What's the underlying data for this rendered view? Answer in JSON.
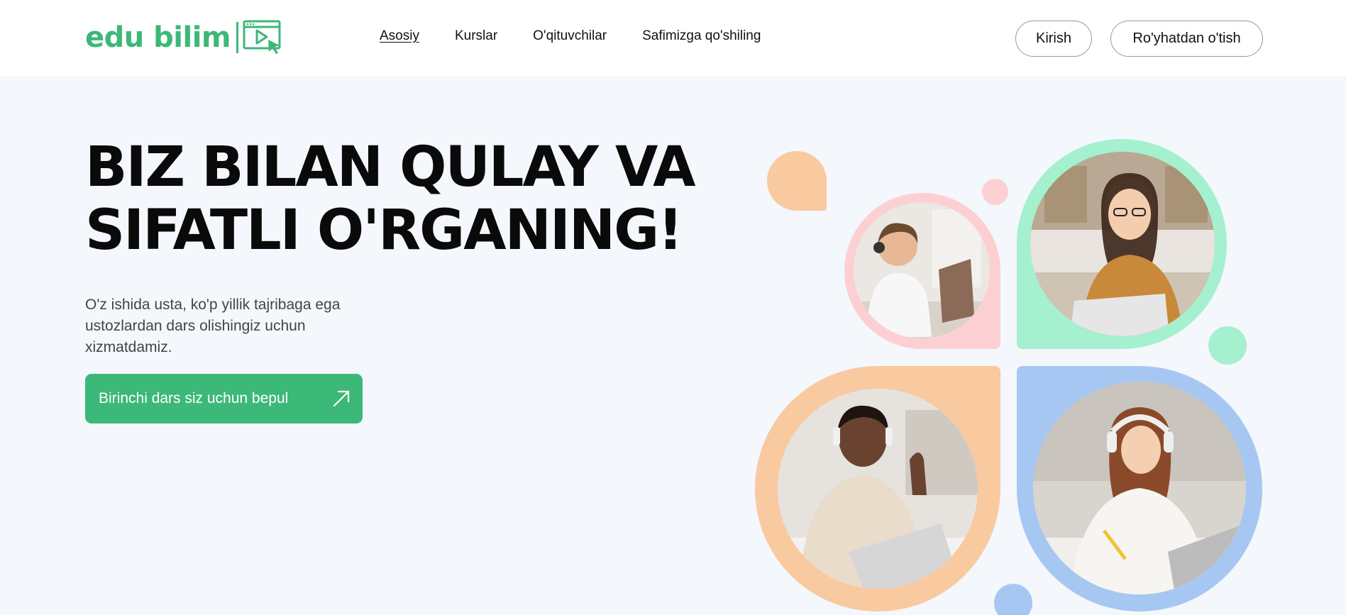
{
  "brand": {
    "logo_text": "edu bilim",
    "accent_color": "#3cb878",
    "logo_icon": "video-player-cursor-icon"
  },
  "nav": {
    "items": [
      {
        "label": "Asosiy",
        "active": true
      },
      {
        "label": "Kurslar",
        "active": false
      },
      {
        "label": "O'qituvchilar",
        "active": false
      },
      {
        "label": "Safimizga qo'shiling",
        "active": false
      }
    ]
  },
  "auth": {
    "login_label": "Kirish",
    "register_label": "Ro'yhatdan o'tish"
  },
  "hero": {
    "title_line1": "BIZ BILAN QULAY VA",
    "title_line2": "SIFATLI O'RGANING!",
    "subtitle": "O'z ishida usta, ko'p yillik tajribaga ega ustozlardan dars olishingiz uchun xizmatdamiz.",
    "cta_label": "Birinchi dars siz uchun bepul",
    "cta_icon": "arrow-up-right-icon"
  },
  "collage": {
    "colors": {
      "peach": "#f9c9a0",
      "pink": "#fcd0d2",
      "mint": "#a4f0cf",
      "blue": "#a5c7f2"
    },
    "photos": [
      {
        "name": "boy-with-headset-tablet",
        "icon": "student-photo"
      },
      {
        "name": "woman-with-headset-laptop",
        "icon": "teacher-photo"
      },
      {
        "name": "man-with-headphones-waving",
        "icon": "student-photo"
      },
      {
        "name": "woman-with-headphones-writing",
        "icon": "student-photo"
      }
    ]
  }
}
